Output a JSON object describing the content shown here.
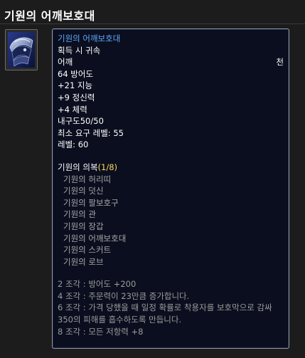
{
  "page_title": "기원의 어깨보호대",
  "item": {
    "name": "기원의 어깨보호대",
    "binding": "획득 시 귀속",
    "slot": "어깨",
    "material": "천",
    "defense": "64 방어도",
    "stats": [
      "+21 지능",
      "+9 정신력",
      "+4 체력"
    ],
    "durability": "내구도50/50",
    "required_level": "최소 요구 레벨: 55",
    "item_level": "레벨: 60"
  },
  "set": {
    "name": "기원의 의복",
    "count": "(1/8)",
    "members": [
      "기원의 허리띠",
      "기원의 덧신",
      "기원의 팔보호구",
      "기원의 관",
      "기원의 장갑",
      "기원의 어깨보호대",
      "기원의 스커트",
      "기원의 로브"
    ],
    "bonuses": [
      "2 조각 : 방어도 +200",
      "4 조각 : 주문력이 23만큼 증가합니다.",
      "6 조각 : 가격 당했을 때 일정 확률로 착용자를 보호막으로 감싸 350의 피해를 흡수하도록 만듭니다.",
      "8 조각 : 모든 저항력 +8"
    ]
  },
  "colors": {
    "item_name": "#5da9ff",
    "set_bonus": "#ffd84a",
    "set_member": "#a8a8a8",
    "tooltip_bg": "#0a0e1e"
  },
  "icon": "shoulder-armor-icon"
}
